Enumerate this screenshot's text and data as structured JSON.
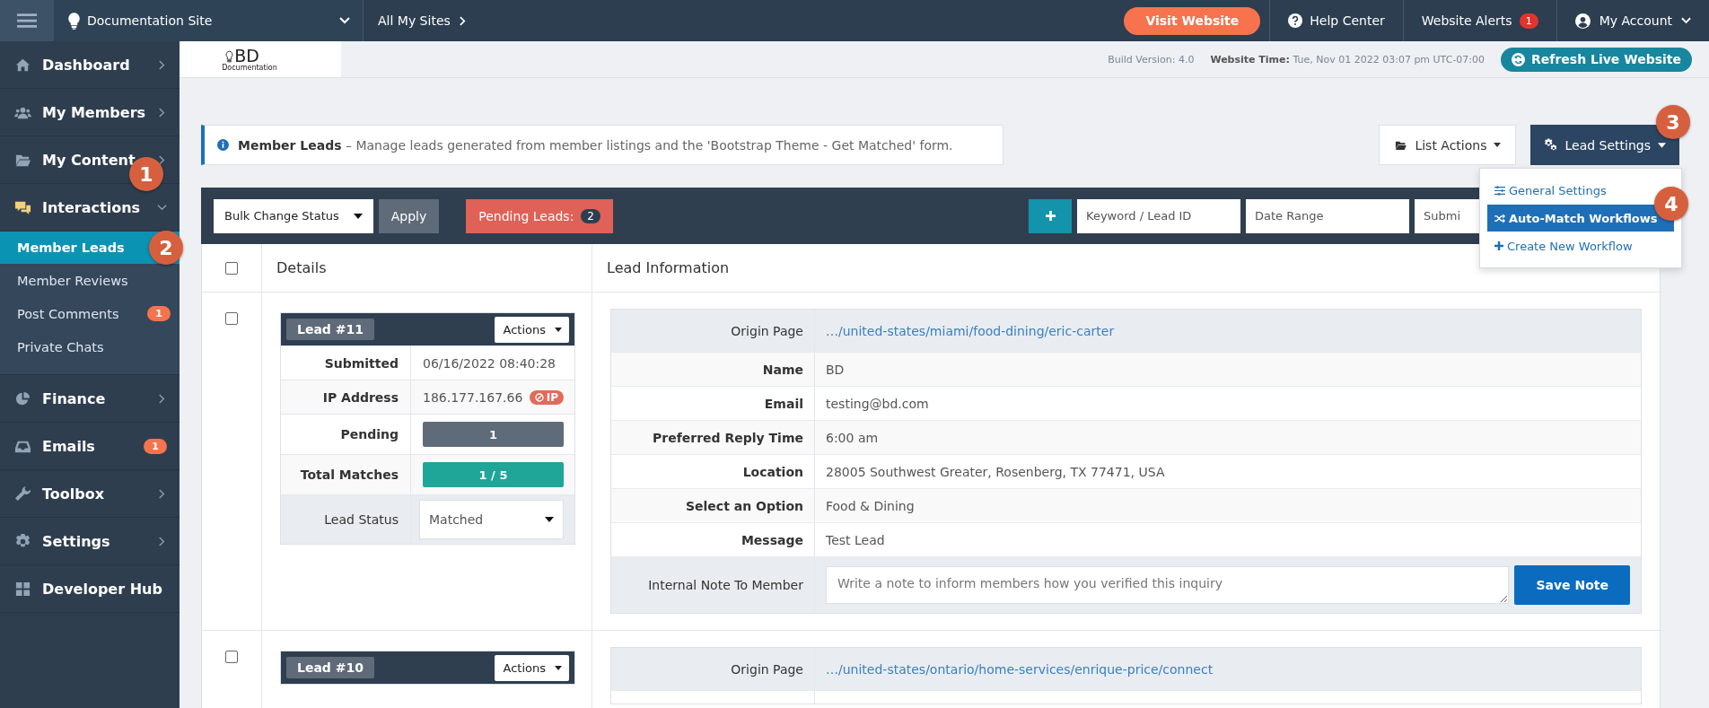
{
  "top_bar": {
    "site": "Documentation Site",
    "all_sites": "All My Sites",
    "visit_button": "Visit Website",
    "help": "Help Center",
    "alerts": {
      "label": "Website Alerts",
      "count": "1"
    },
    "account": "My Account"
  },
  "header": {
    "logo_text": "BD",
    "logo_sub": "Documentation",
    "build": "Build Version: 4.0",
    "time_label": "Website Time:",
    "time_value": "Tue, Nov 01 2022 03:07 pm UTC-07:00",
    "refresh_button": "Refresh Live Website"
  },
  "sidebar": {
    "items": [
      {
        "label": "Dashboard",
        "kind": "group",
        "expanded": false
      },
      {
        "label": "My Members",
        "kind": "group",
        "expanded": false
      },
      {
        "label": "My Content",
        "kind": "group",
        "expanded": false
      },
      {
        "label": "Interactions",
        "kind": "group",
        "expanded": true,
        "callout": "1",
        "children": [
          {
            "label": "Member Leads",
            "selected": true,
            "callout": "2"
          },
          {
            "label": "Member Reviews",
            "selected": false
          },
          {
            "label": "Post Comments",
            "selected": false,
            "badge": "1"
          },
          {
            "label": "Private Chats",
            "selected": false
          }
        ]
      },
      {
        "label": "Finance",
        "kind": "group",
        "expanded": false
      },
      {
        "label": "Emails",
        "kind": "badge",
        "badge": "1"
      },
      {
        "label": "Toolbox",
        "kind": "group",
        "expanded": false
      },
      {
        "label": "Settings",
        "kind": "group",
        "expanded": false
      },
      {
        "label": "Developer Hub",
        "kind": "link"
      }
    ]
  },
  "notice": {
    "title": "Member Leads",
    "text": "– Manage leads generated from member listings and the 'Bootstrap Theme - Get Matched' form."
  },
  "list_actions": "List Actions",
  "lead_settings": {
    "label": "Lead Settings",
    "expanded": true,
    "callout": "3",
    "menu": [
      {
        "label": "General Settings",
        "selected": false
      },
      {
        "label": "Auto-Match Workflows",
        "selected": true,
        "callout": "4"
      },
      {
        "label": "Create New Workflow",
        "selected": false
      }
    ]
  },
  "toolbar": {
    "bulk_select": "Bulk Change Status",
    "apply": "Apply",
    "pending": {
      "label": "Pending Leads:",
      "count": "2"
    },
    "keyword_placeholder": "Keyword / Lead ID",
    "date_placeholder": "Date Range",
    "submit_placeholder": "Submi"
  },
  "table": {
    "header_checked": false,
    "columns": [
      "Details",
      "Lead Information"
    ],
    "rows": [
      {
        "checked": false,
        "lead": "Lead #11",
        "actions": "Actions",
        "details": [
          {
            "label": "Submitted",
            "value": "06/16/2022 08:40:28",
            "kind": "text"
          },
          {
            "label": "IP Address",
            "value": "186.177.167.66",
            "kind": "ip",
            "tag": "IP"
          },
          {
            "label": "Pending",
            "value": "1",
            "kind": "pending"
          },
          {
            "label": "Total Matches",
            "value": "1 / 5",
            "kind": "matches"
          },
          {
            "label": "Lead Status",
            "value": "Matched",
            "kind": "select"
          }
        ],
        "info": [
          {
            "label": "Origin Page",
            "value": "…/united-states/miami/food-dining/eric-carter",
            "kind": "link"
          },
          {
            "label": "Name",
            "value": "BD",
            "kind": "text"
          },
          {
            "label": "Email",
            "value": "testing@bd.com",
            "kind": "text"
          },
          {
            "label": "Preferred Reply Time",
            "value": "6:00 am",
            "kind": "text"
          },
          {
            "label": "Location",
            "value": "28005 Southwest Greater, Rosenberg, TX 77471, USA",
            "kind": "text"
          },
          {
            "label": "Select an Option",
            "value": "Food & Dining",
            "kind": "text"
          },
          {
            "label": "Message",
            "value": "Test Lead",
            "kind": "text"
          },
          {
            "label": "Internal Note To Member",
            "placeholder": "Write a note to inform members how you verified this inquiry",
            "button": "Save Note",
            "kind": "note"
          }
        ]
      },
      {
        "checked": false,
        "lead": "Lead #10",
        "actions": "Actions",
        "details": [],
        "info": [
          {
            "label": "Origin Page",
            "value": "…/united-states/ontario/home-services/enrique-price/connect",
            "kind": "link"
          }
        ]
      }
    ]
  }
}
